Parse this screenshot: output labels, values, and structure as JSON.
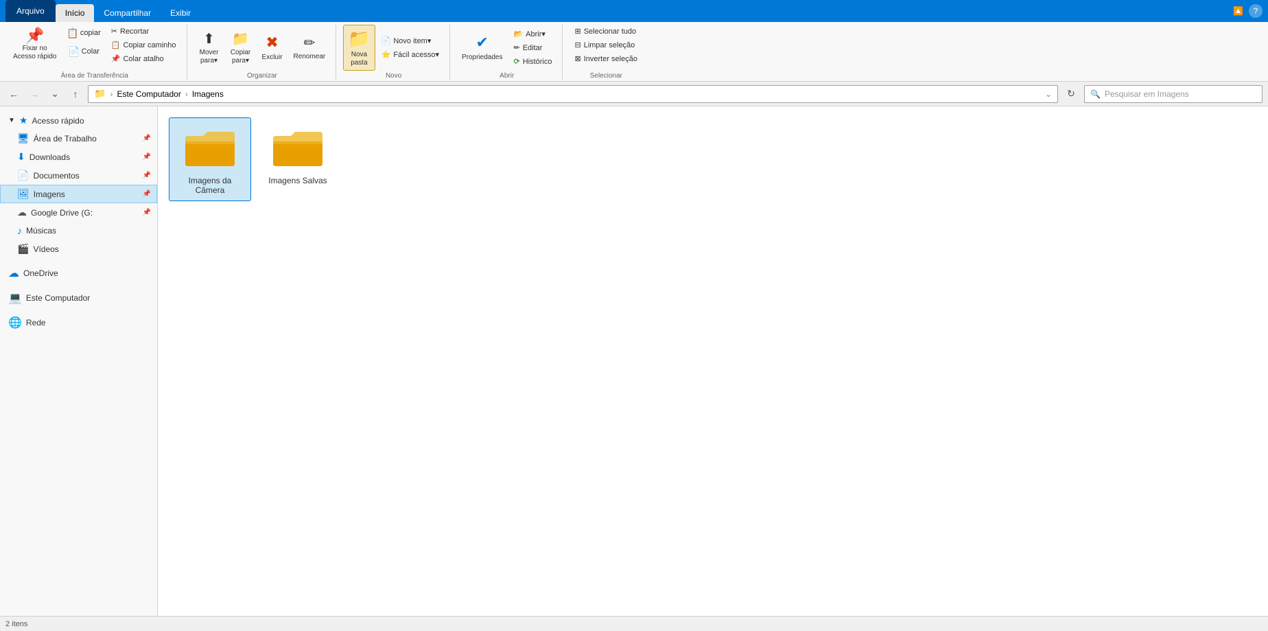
{
  "titleBar": {
    "tabs": [
      {
        "id": "arquivo",
        "label": "Arquivo",
        "active": true
      },
      {
        "id": "inicio",
        "label": "Início",
        "active": false
      },
      {
        "id": "compartilhar",
        "label": "Compartilhar",
        "active": false
      },
      {
        "id": "exibir",
        "label": "Exibir",
        "active": false
      }
    ],
    "helpIcon": "?"
  },
  "ribbon": {
    "groups": [
      {
        "id": "area-transferencia",
        "label": "Área de Transferência",
        "items": [
          {
            "id": "fixar",
            "label": "Fixar no\nAcesso rápido",
            "icon": "📌"
          },
          {
            "id": "copiar",
            "label": "Copiar",
            "icon": "📋"
          },
          {
            "id": "colar",
            "label": "Colar",
            "icon": "📄"
          },
          {
            "id": "recortar",
            "label": "Recortar",
            "icon": "✂"
          },
          {
            "id": "copiar-caminho",
            "label": "Copiar caminho",
            "icon": ""
          },
          {
            "id": "colar-atalho",
            "label": "Colar atalho",
            "icon": ""
          }
        ]
      },
      {
        "id": "organizar",
        "label": "Organizar",
        "items": [
          {
            "id": "mover-para",
            "label": "Mover\npara▾",
            "icon": "⬆"
          },
          {
            "id": "copiar-para",
            "label": "Copiar\npara▾",
            "icon": "📁"
          },
          {
            "id": "excluir",
            "label": "Excluir",
            "icon": "✖"
          },
          {
            "id": "renomear",
            "label": "Renomear",
            "icon": "✏"
          }
        ]
      },
      {
        "id": "novo",
        "label": "Novo",
        "items": [
          {
            "id": "nova-pasta",
            "label": "Nova\npasta",
            "icon": "📁",
            "highlighted": true
          },
          {
            "id": "novo-item",
            "label": "Novo item▾",
            "icon": ""
          },
          {
            "id": "facil-acesso",
            "label": "Fácil acesso▾",
            "icon": ""
          }
        ]
      },
      {
        "id": "abrir",
        "label": "Abrir",
        "items": [
          {
            "id": "propriedades",
            "label": "Propriedades",
            "icon": "ℹ"
          },
          {
            "id": "abrir",
            "label": "Abrir▾",
            "icon": ""
          },
          {
            "id": "editar",
            "label": "Editar",
            "icon": ""
          },
          {
            "id": "historico",
            "label": "Histórico",
            "icon": ""
          }
        ]
      },
      {
        "id": "selecionar",
        "label": "Selecionar",
        "items": [
          {
            "id": "selecionar-tudo",
            "label": "Selecionar tudo",
            "icon": ""
          },
          {
            "id": "limpar-selecao",
            "label": "Limpar seleção",
            "icon": ""
          },
          {
            "id": "inverter-selecao",
            "label": "Inverter seleção",
            "icon": ""
          }
        ]
      }
    ]
  },
  "addressBar": {
    "backDisabled": false,
    "forwardDisabled": true,
    "upDisabled": false,
    "path": "Este Computador > Imagens",
    "pathParts": [
      "Este Computador",
      "Imagens"
    ],
    "searchPlaceholder": "Pesquisar em Imagens"
  },
  "sidebar": {
    "quickAccess": {
      "label": "Acesso rápido",
      "items": [
        {
          "id": "area-trabalho",
          "label": "Área de Trabalho",
          "icon": "🖥",
          "pinned": true
        },
        {
          "id": "downloads",
          "label": "Downloads",
          "icon": "⬇",
          "pinned": true
        },
        {
          "id": "documentos",
          "label": "Documentos",
          "icon": "📄",
          "pinned": true
        },
        {
          "id": "imagens",
          "label": "Imagens",
          "icon": "🖼",
          "pinned": true,
          "active": true
        }
      ]
    },
    "googleDrive": {
      "label": "Google Drive (G:",
      "icon": "☁",
      "pinned": true
    },
    "musicas": {
      "label": "Músicas",
      "icon": "♪"
    },
    "videos": {
      "label": "Vídeos",
      "icon": "🎬"
    },
    "onedrive": {
      "label": "OneDrive",
      "icon": "☁"
    },
    "esteComputador": {
      "label": "Este Computador",
      "icon": "💻"
    },
    "rede": {
      "label": "Rede",
      "icon": "🌐"
    }
  },
  "content": {
    "folders": [
      {
        "id": "imagens-camera",
        "label": "Imagens da\nCâmera",
        "selected": true
      },
      {
        "id": "imagens-salvas",
        "label": "Imagens Salvas",
        "selected": false
      }
    ]
  },
  "statusBar": {
    "text": "2 itens"
  }
}
